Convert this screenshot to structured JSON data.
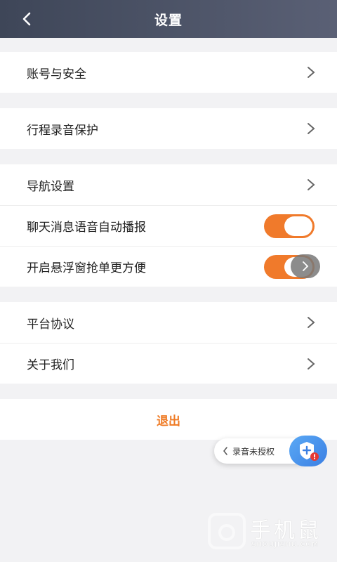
{
  "header": {
    "title": "设置"
  },
  "sections": {
    "s1": {
      "account": "账号与安全"
    },
    "s2": {
      "trip_recording": "行程录音保护"
    },
    "s3": {
      "navigation": "导航设置",
      "chat_voice": "聊天消息语音自动播报",
      "chat_voice_on": true,
      "float_window": "开启悬浮窗抢单更方便",
      "float_window_on": true
    },
    "s4": {
      "agreement": "平台协议",
      "about": "关于我们"
    }
  },
  "logout": {
    "label": "退出"
  },
  "floating": {
    "recording_label": "录音未授权"
  },
  "watermark": {
    "brand": "手机鼠",
    "url": "SHOUJISHU.COM"
  },
  "colors": {
    "accent": "#f07a2b",
    "logout_text": "#ef7a24",
    "header": "#4a5166"
  }
}
